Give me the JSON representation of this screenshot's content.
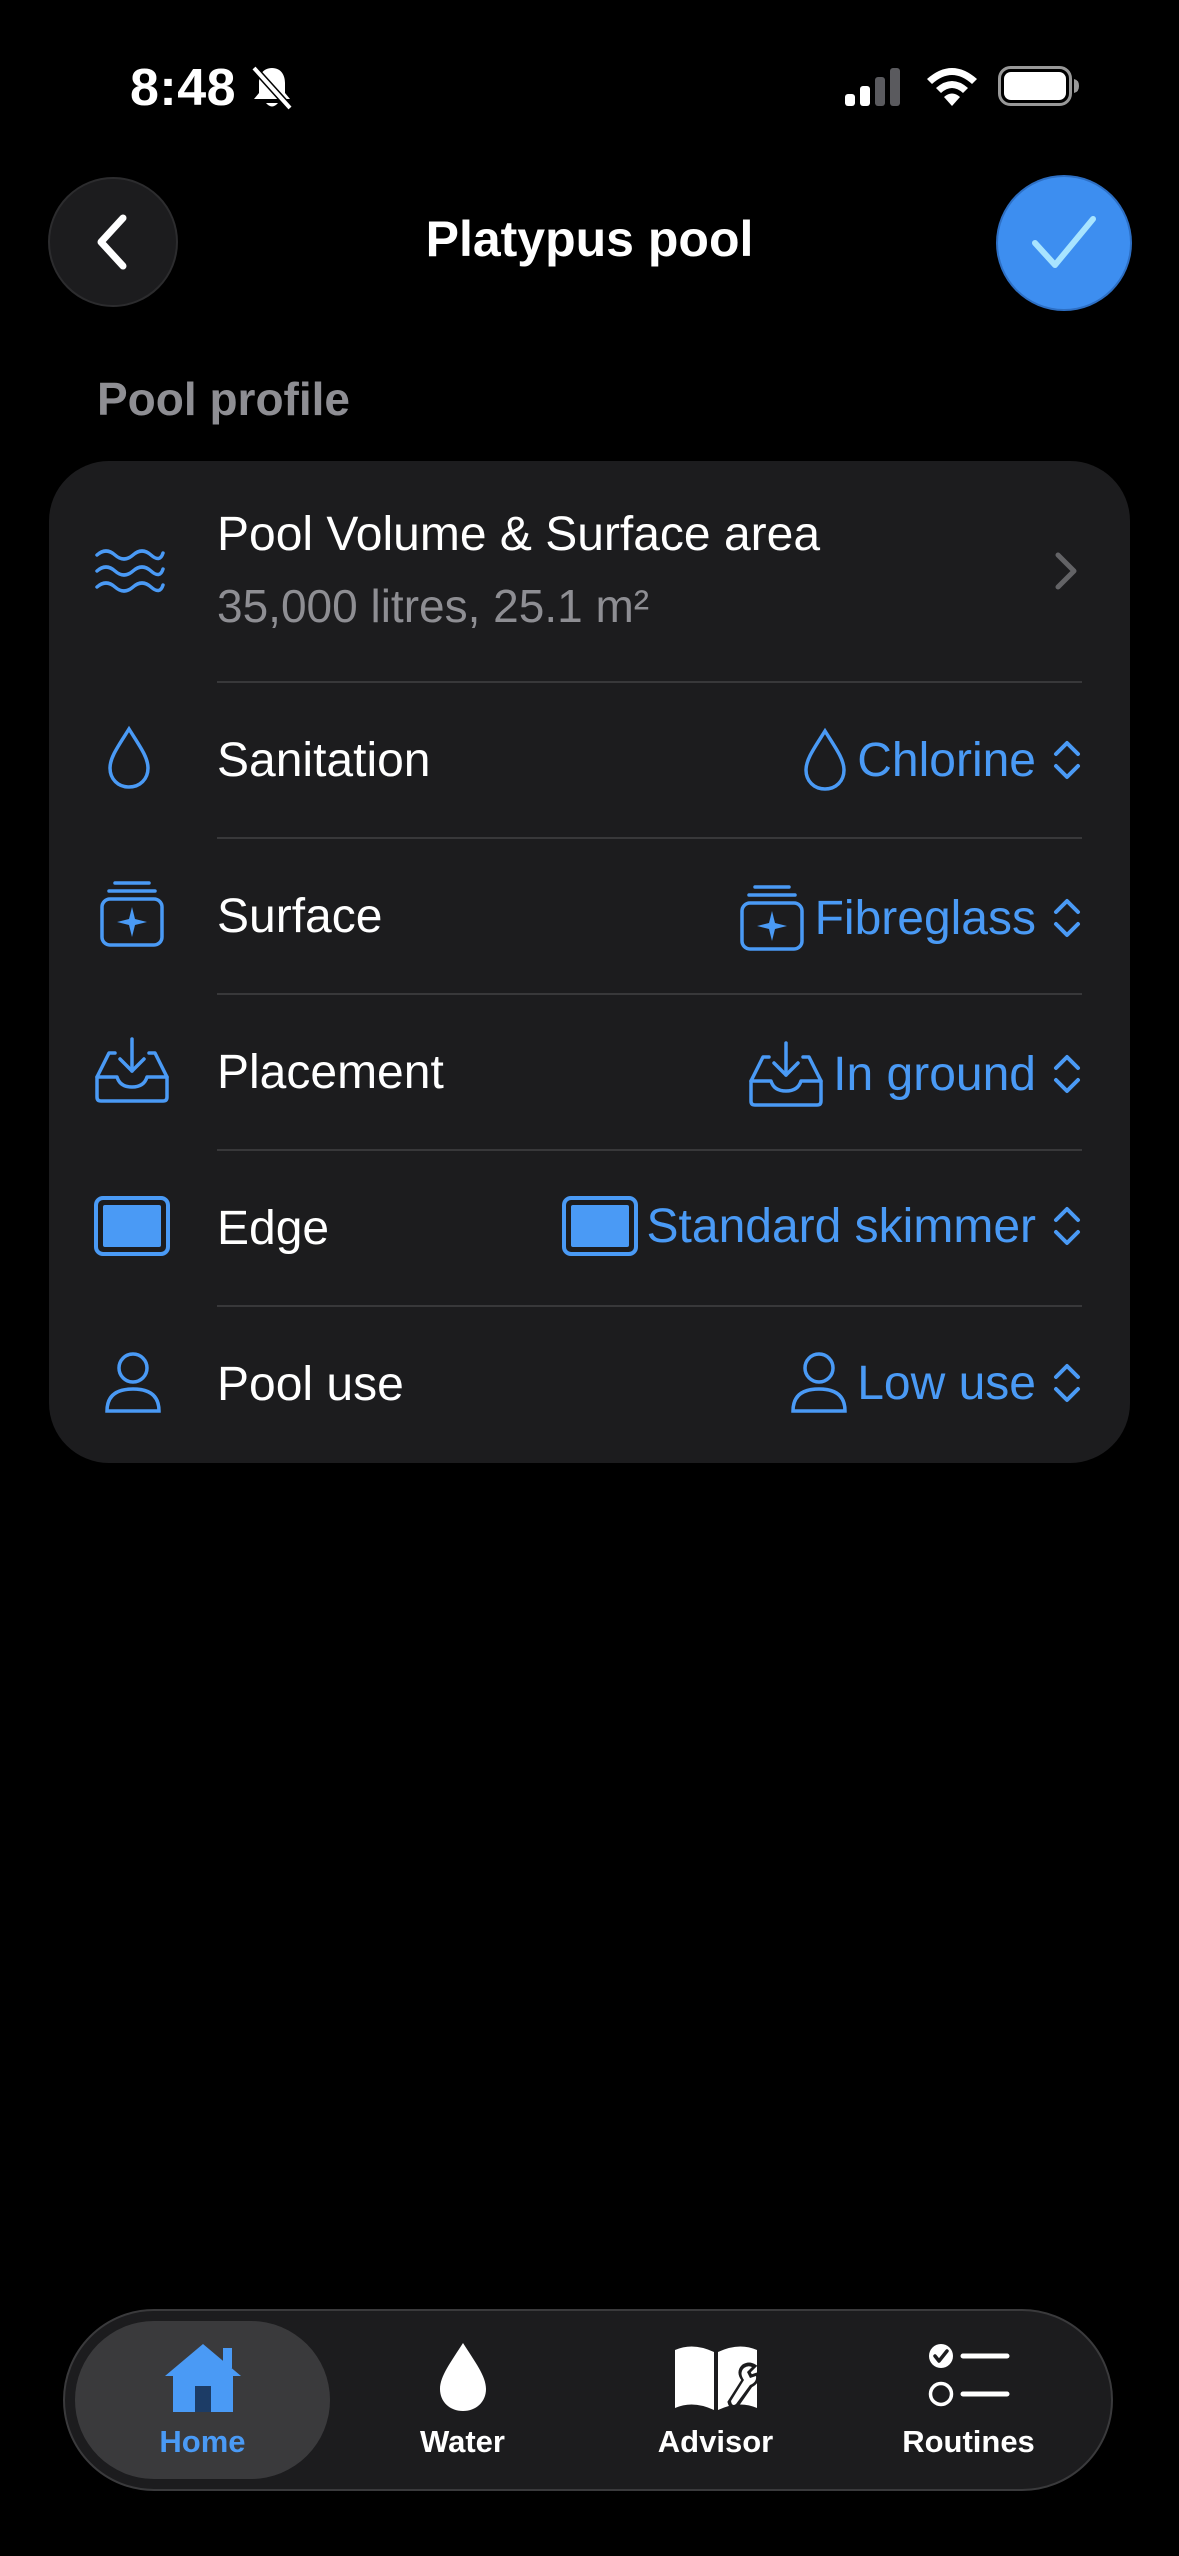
{
  "status_bar": {
    "time": "8:48"
  },
  "header": {
    "title": "Platypus pool"
  },
  "section": {
    "label": "Pool profile"
  },
  "profile": {
    "volume": {
      "label": "Pool Volume & Surface area",
      "value": "35,000 litres, 25.1 m²"
    },
    "sanitation": {
      "label": "Sanitation",
      "value": "Chlorine"
    },
    "surface": {
      "label": "Surface",
      "value": "Fibreglass"
    },
    "placement": {
      "label": "Placement",
      "value": "In ground"
    },
    "edge": {
      "label": "Edge",
      "value": "Standard skimmer"
    },
    "use": {
      "label": "Pool use",
      "value": "Low use"
    }
  },
  "tabs": [
    {
      "label": "Home",
      "icon": "house-icon",
      "active": true
    },
    {
      "label": "Water",
      "icon": "droplet-icon"
    },
    {
      "label": "Advisor",
      "icon": "book-wrench-icon"
    },
    {
      "label": "Routines",
      "icon": "checklist-icon"
    }
  ],
  "colors": {
    "accent": "#4a9af5",
    "background": "#000000",
    "card": "#1c1c1e",
    "secondary_text": "#8e8e93"
  }
}
